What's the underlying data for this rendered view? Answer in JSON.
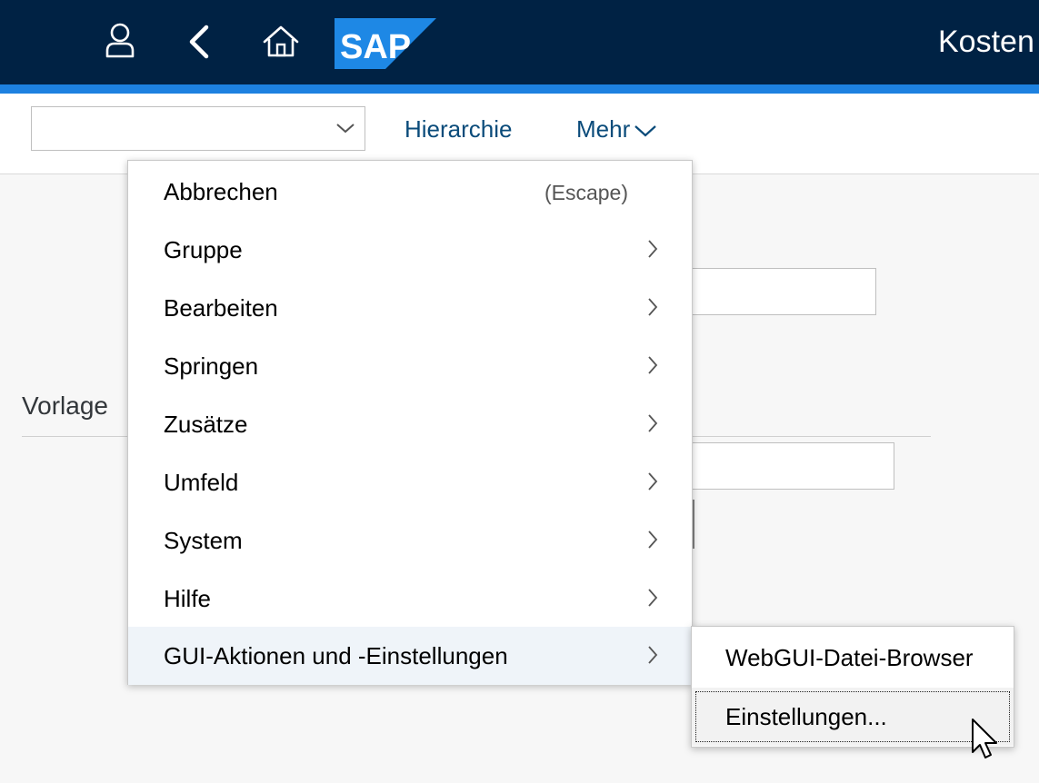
{
  "shell": {
    "title": "Kosten",
    "icons": {
      "user": "user-icon",
      "back": "back-arrow-icon",
      "home": "home-icon"
    },
    "logo_text": "SAP",
    "colors": {
      "bar": "#002244",
      "accent": "#1d81e0",
      "logo": "#1e88e5"
    }
  },
  "toolbar": {
    "combo_value": "",
    "hierarchie_label": "Hierarchie",
    "mehr_label": "Mehr"
  },
  "content": {
    "vorlage_label": "Vorlage"
  },
  "menu": {
    "items": [
      {
        "label": "Abbrechen",
        "shortcut": "(Escape)"
      },
      {
        "label": "Gruppe"
      },
      {
        "label": "Bearbeiten"
      },
      {
        "label": "Springen"
      },
      {
        "label": "Zusätze"
      },
      {
        "label": "Umfeld"
      },
      {
        "label": "System"
      },
      {
        "label": "Hilfe"
      },
      {
        "label": "GUI-Aktionen und -Einstellungen",
        "active": true
      }
    ]
  },
  "submenu": {
    "items": [
      {
        "label": "WebGUI-Datei-Browser"
      },
      {
        "label": "Einstellungen...",
        "focused": true
      }
    ]
  }
}
